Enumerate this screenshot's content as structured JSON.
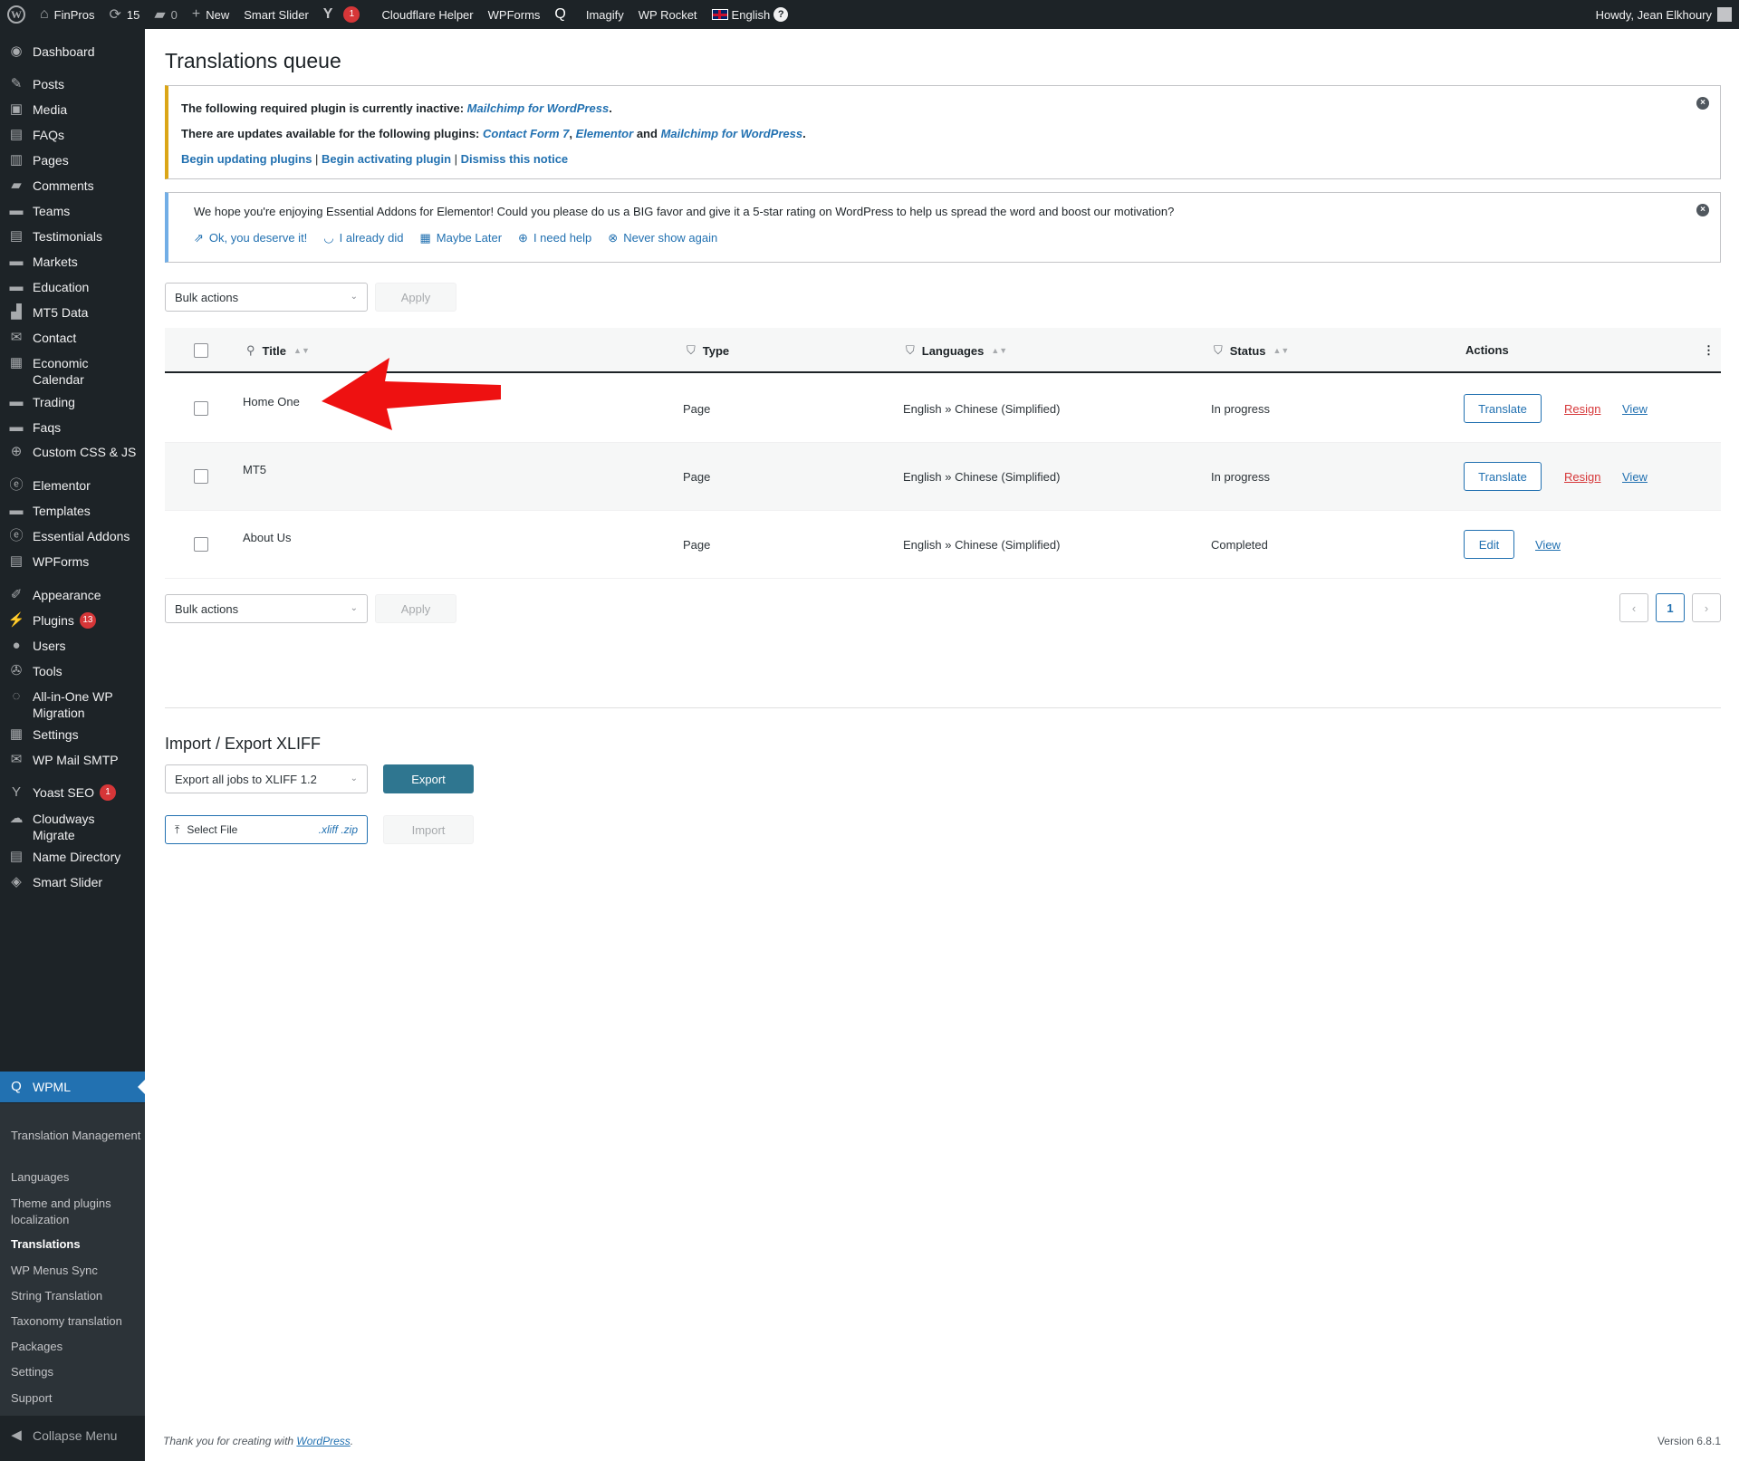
{
  "adminbar": {
    "site_name": "FinPros",
    "updates_count": "15",
    "comments_count": "0",
    "new_label": "New",
    "smart_slider": "Smart Slider",
    "yoast_badge": "1",
    "cloudflare": "Cloudflare Helper",
    "wpforms": "WPForms",
    "imagify": "Imagify",
    "wp_rocket": "WP Rocket",
    "language": "English",
    "howdy": "Howdy, Jean Elkhoury"
  },
  "sidebar": {
    "items": [
      {
        "label": "Dashboard",
        "icon": "dashboard-icon"
      },
      {
        "label": "Posts",
        "icon": "pin-icon"
      },
      {
        "label": "Media",
        "icon": "media-icon"
      },
      {
        "label": "FAQs",
        "icon": "faq-icon"
      },
      {
        "label": "Pages",
        "icon": "pages-icon"
      },
      {
        "label": "Comments",
        "icon": "comment-icon"
      },
      {
        "label": "Teams",
        "icon": "folder-icon"
      },
      {
        "label": "Testimonials",
        "icon": "testimonial-icon"
      },
      {
        "label": "Markets",
        "icon": "folder-icon"
      },
      {
        "label": "Education",
        "icon": "folder-icon"
      },
      {
        "label": "MT5 Data",
        "icon": "chart-icon"
      },
      {
        "label": "Contact",
        "icon": "mail-icon"
      },
      {
        "label": "Economic Calendar",
        "icon": "calendar-icon"
      },
      {
        "label": "Trading",
        "icon": "folder-icon"
      },
      {
        "label": "Faqs",
        "icon": "folder-icon"
      },
      {
        "label": "Custom CSS & JS",
        "icon": "plus-circle-icon"
      },
      {
        "label": "Elementor",
        "icon": "elementor-icon"
      },
      {
        "label": "Templates",
        "icon": "folder-icon"
      },
      {
        "label": "Essential Addons",
        "icon": "ea-icon"
      },
      {
        "label": "WPForms",
        "icon": "form-icon"
      },
      {
        "label": "Appearance",
        "icon": "brush-icon"
      },
      {
        "label": "Plugins",
        "icon": "plugin-icon",
        "badge": "13"
      },
      {
        "label": "Users",
        "icon": "user-icon"
      },
      {
        "label": "Tools",
        "icon": "wrench-icon"
      },
      {
        "label": "All-in-One WP Migration",
        "icon": "migration-icon"
      },
      {
        "label": "Settings",
        "icon": "settings-icon"
      },
      {
        "label": "WP Mail SMTP",
        "icon": "mail-icon"
      },
      {
        "label": "Yoast SEO",
        "icon": "yoast-icon",
        "badge": "1"
      },
      {
        "label": "Cloudways Migrate",
        "icon": "cloud-icon"
      },
      {
        "label": "Name Directory",
        "icon": "directory-icon"
      },
      {
        "label": "Smart Slider",
        "icon": "slider-icon"
      }
    ],
    "current": {
      "label": "WPML",
      "icon": "wpml-icon"
    },
    "submenu": [
      {
        "label": "Translation Management"
      },
      {
        "label": "Languages"
      },
      {
        "label": "Theme and plugins localization"
      },
      {
        "label": "Translations"
      },
      {
        "label": "WP Menus Sync"
      },
      {
        "label": "String Translation"
      },
      {
        "label": "Taxonomy translation"
      },
      {
        "label": "Packages"
      },
      {
        "label": "Settings"
      },
      {
        "label": "Support"
      }
    ],
    "collapse": "Collapse Menu"
  },
  "page": {
    "title": "Translations queue"
  },
  "notice_plugins": {
    "line1_text": "The following required plugin is currently inactive:",
    "line1_link": "Mailchimp for WordPress",
    "line2_text": "There are updates available for the following plugins:",
    "line2_link1": "Contact Form 7",
    "line2_link2": "Elementor",
    "line2_and": "and",
    "line2_link3": "Mailchimp for WordPress",
    "action1": "Begin updating plugins",
    "action2": "Begin activating plugin",
    "action3": "Dismiss this notice"
  },
  "notice_ea": {
    "message": "We hope you're enjoying Essential Addons for Elementor! Could you please do us a BIG favor and give it a 5-star rating on WordPress to help us spread the word and boost our motivation?",
    "links": [
      "Ok, you deserve it!",
      "I already did",
      "Maybe Later",
      "I need help",
      "Never show again"
    ]
  },
  "bulk": {
    "label": "Bulk actions",
    "apply": "Apply"
  },
  "table": {
    "headers": {
      "title": "Title",
      "type": "Type",
      "languages": "Languages",
      "status": "Status",
      "actions": "Actions"
    },
    "rows": [
      {
        "title": "Home One",
        "type": "Page",
        "languages": "English » Chinese (Simplified)",
        "status": "In progress",
        "primary": "Translate",
        "resign": "Resign",
        "view": "View"
      },
      {
        "title": "MT5",
        "type": "Page",
        "languages": "English » Chinese (Simplified)",
        "status": "In progress",
        "primary": "Translate",
        "resign": "Resign",
        "view": "View"
      },
      {
        "title": "About Us",
        "type": "Page",
        "languages": "English » Chinese (Simplified)",
        "status": "Completed",
        "primary": "Edit",
        "view": "View"
      }
    ]
  },
  "pagination": {
    "prev": "‹",
    "current": "1",
    "next": "›"
  },
  "xliff": {
    "title": "Import / Export XLIFF",
    "export_select": "Export all jobs to XLIFF 1.2",
    "export_button": "Export",
    "select_file": "Select File",
    "extensions": ".xliff .zip",
    "import_button": "Import"
  },
  "footer": {
    "thanks_text": "Thank you for creating with",
    "thanks_link": "WordPress",
    "version": "Version 6.8.1"
  },
  "colors": {
    "accent": "#2271b1",
    "sidebar": "#1d2327",
    "current_menu": "#2271b1",
    "danger": "#d63638",
    "export_button": "#2f7690"
  }
}
